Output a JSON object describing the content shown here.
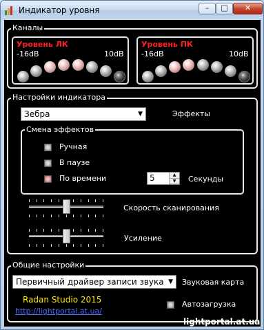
{
  "window": {
    "title": "Индикатор уровня",
    "minimize": "–",
    "maximize": "□",
    "close": "✕"
  },
  "channels": {
    "legend": "Каналы",
    "left": {
      "label": "Уровень ЛК",
      "min": "-16dB",
      "max": "10dB",
      "leds": [
        "grey",
        "grey",
        "pink",
        "pink",
        "pink",
        "grey",
        "grey",
        "dark"
      ]
    },
    "right": {
      "label": "Уровень ПК",
      "min": "-16dB",
      "max": "10dB",
      "leds": [
        "grey",
        "grey",
        "pink",
        "pink",
        "grey",
        "grey",
        "grey",
        "dark"
      ]
    }
  },
  "indicator": {
    "legend": "Настройки индикатора",
    "effect_value": "Зебра",
    "effect_label": "Эффекты",
    "change": {
      "legend": "Смена эффектов",
      "manual": "Ручная",
      "pause": "В паузе",
      "by_time": "По времени",
      "seconds_value": "5",
      "seconds_label": "Секунды"
    },
    "scan_speed_label": "Скорость сканирования",
    "gain_label": "Усиление",
    "scan_speed_level": 0.5,
    "gain_level": 0.5
  },
  "general": {
    "legend": "Общие настройки",
    "device_value": "Первичный драйвер записи звука",
    "device_label": "Звуковая карта",
    "studio": "Radan Studio 2015",
    "url": "http://lightportal.at.ua/",
    "autoload": "Автозагрузка"
  },
  "watermark": "lightportal.at.ua"
}
